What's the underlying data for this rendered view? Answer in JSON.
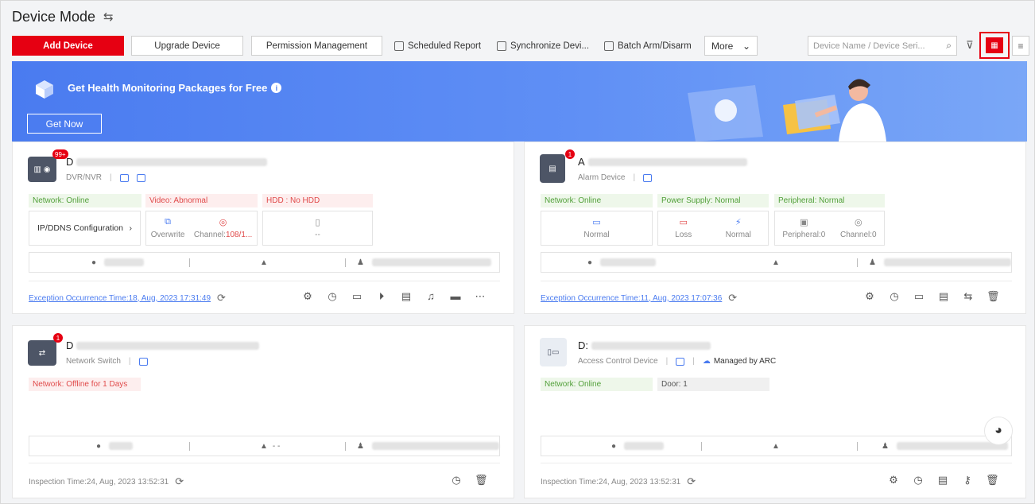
{
  "header": {
    "title": "Device Mode",
    "switch_icon": "switch-arrows-icon"
  },
  "toolbar": {
    "add_device": "Add Device",
    "upgrade_device": "Upgrade Device",
    "permission_management": "Permission Management",
    "scheduled_report": "Scheduled Report",
    "synchronize": "Synchronize Devi...",
    "batch_arm": "Batch Arm/Disarm",
    "more": "More",
    "search_placeholder": "Device Name / Device Seri..."
  },
  "banner": {
    "title": "Get Health Monitoring Packages for Free",
    "button": "Get Now"
  },
  "cards": [
    {
      "badge": "99+",
      "name_prefix": "D",
      "type": "DVR/NVR",
      "tags": [
        "Network: Online",
        "Video: Abnormal",
        "HDD : No HDD"
      ],
      "link_tile": "IP/DDNS Configuration",
      "overwrite": "Overwrite",
      "channel_prefix": "Channel:",
      "channel_value": "108/1...",
      "hdd_value": "--",
      "exception": "Exception Occurrence Time:18, Aug, 2023 17:31:49"
    },
    {
      "badge": "1",
      "name_prefix": "A",
      "type": "Alarm Device",
      "tags": [
        "Network: Online",
        "Power Supply: Normal",
        "Peripheral: Normal"
      ],
      "tiles": [
        {
          "label": "Normal"
        },
        {
          "label": "Loss",
          "label2": "Normal"
        },
        {
          "label": "Peripheral:0",
          "label2": "Channel:0"
        }
      ],
      "exception": "Exception Occurrence Time:11, Aug, 2023 17:07:36"
    },
    {
      "badge": "1",
      "name_prefix": "D",
      "type": "Network Switch",
      "tags": [
        "Network: Offline for 1 Days"
      ],
      "user_value": "- -",
      "inspection": "Inspection Time:24, Aug, 2023 13:52:31"
    },
    {
      "name_prefix": "D:",
      "type": "Access Control Device",
      "managed": "Managed by ARC",
      "tags": [
        "Network: Online",
        "Door: 1"
      ],
      "inspection": "Inspection Time:24, Aug, 2023 13:52:31"
    }
  ],
  "colors": {
    "brand_red": "#e60012",
    "banner_blue": "#4a7bf0",
    "ok_green": "#52a03a",
    "bad_red": "#e04a4a"
  }
}
